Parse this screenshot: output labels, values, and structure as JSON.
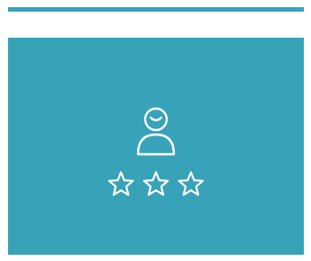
{
  "colors": {
    "accent": "#38A2B8",
    "icon_stroke": "#ffffff",
    "background": "#ffffff"
  },
  "illustration": {
    "icon": "user-rating-icon",
    "person_expression": "smiling",
    "rating": {
      "stars_shown": 3,
      "style": "outline"
    }
  }
}
